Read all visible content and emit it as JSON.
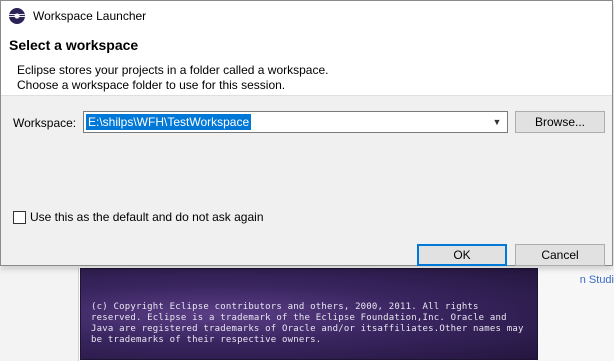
{
  "window": {
    "title": "Workspace Launcher"
  },
  "header": {
    "heading": "Select a workspace",
    "description_line1": "Eclipse stores your projects in a folder called a workspace.",
    "description_line2": "Choose a workspace folder to use for this session."
  },
  "workspace": {
    "label": "Workspace:",
    "value": "E:\\shilps\\WFH\\TestWorkspace",
    "browse_label": "Browse..."
  },
  "options": {
    "default_checkbox_label": "Use this as the default and do not ask again",
    "default_checked": false
  },
  "buttons": {
    "ok_label": "OK",
    "cancel_label": "Cancel"
  },
  "background": {
    "splash_text": "(c) Copyright Eclipse contributors and others, 2000, 2011.  All rights reserved. Eclipse is a trademark of the Eclipse Foundation,Inc. Oracle and Java are registered trademarks of Oracle and/or itsaffiliates.Other names may be trademarks of their respective owners.",
    "side_link": "n Studi"
  },
  "colors": {
    "selection": "#0078d7",
    "dialog_bg": "#f0f0f0",
    "splash": "#3a2560"
  },
  "icons": {
    "app": "eclipse-icon",
    "combo": "chevron-down-icon"
  }
}
